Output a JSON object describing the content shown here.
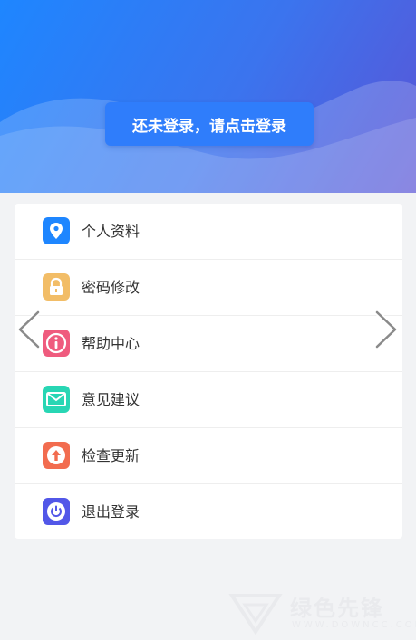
{
  "header": {
    "login_label": "还未登录，请点击登录",
    "gradient_start": "#1e86ff",
    "gradient_end": "#5a55d6"
  },
  "menu": {
    "items": [
      {
        "label": "个人资料",
        "icon": "location-pin-icon",
        "color": "#1e86ff"
      },
      {
        "label": "密码修改",
        "icon": "lock-icon",
        "color": "#f2bd67"
      },
      {
        "label": "帮助中心",
        "icon": "info-icon",
        "color": "#ef5b7e"
      },
      {
        "label": "意见建议",
        "icon": "mail-icon",
        "color": "#28d6b4"
      },
      {
        "label": "检查更新",
        "icon": "upload-arrow-icon",
        "color": "#f26c4f"
      },
      {
        "label": "退出登录",
        "icon": "power-icon",
        "color": "#5257e8"
      }
    ]
  },
  "navigation": {
    "prev_icon": "chevron-left-icon",
    "next_icon": "chevron-right-icon"
  },
  "watermark": {
    "text": "绿色先锋",
    "url": "WWW.DOWNCC.COM"
  }
}
